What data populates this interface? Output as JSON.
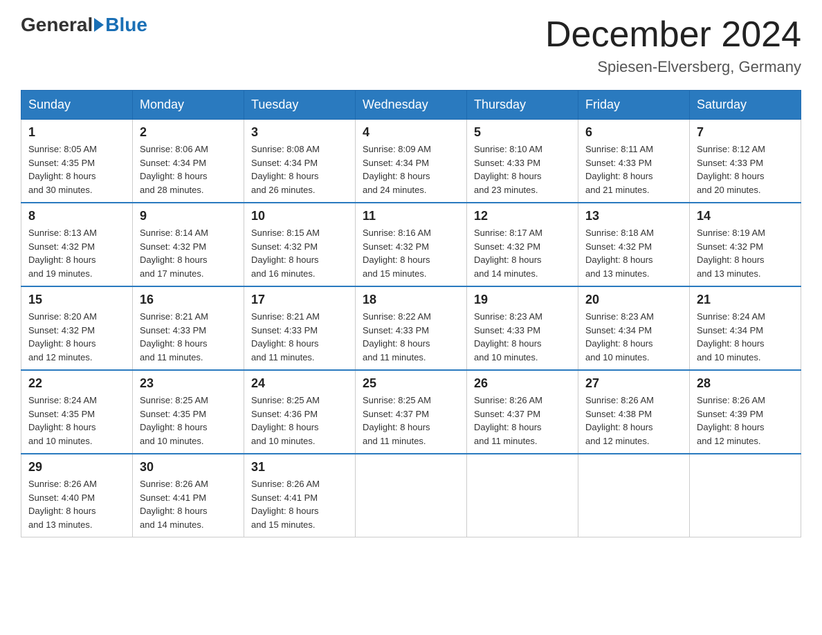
{
  "header": {
    "logo_general": "General",
    "logo_blue": "Blue",
    "title": "December 2024",
    "location": "Spiesen-Elversberg, Germany"
  },
  "days_of_week": [
    "Sunday",
    "Monday",
    "Tuesday",
    "Wednesday",
    "Thursday",
    "Friday",
    "Saturday"
  ],
  "weeks": [
    [
      {
        "day": "1",
        "sunrise": "8:05 AM",
        "sunset": "4:35 PM",
        "daylight": "8 hours and 30 minutes."
      },
      {
        "day": "2",
        "sunrise": "8:06 AM",
        "sunset": "4:34 PM",
        "daylight": "8 hours and 28 minutes."
      },
      {
        "day": "3",
        "sunrise": "8:08 AM",
        "sunset": "4:34 PM",
        "daylight": "8 hours and 26 minutes."
      },
      {
        "day": "4",
        "sunrise": "8:09 AM",
        "sunset": "4:34 PM",
        "daylight": "8 hours and 24 minutes."
      },
      {
        "day": "5",
        "sunrise": "8:10 AM",
        "sunset": "4:33 PM",
        "daylight": "8 hours and 23 minutes."
      },
      {
        "day": "6",
        "sunrise": "8:11 AM",
        "sunset": "4:33 PM",
        "daylight": "8 hours and 21 minutes."
      },
      {
        "day": "7",
        "sunrise": "8:12 AM",
        "sunset": "4:33 PM",
        "daylight": "8 hours and 20 minutes."
      }
    ],
    [
      {
        "day": "8",
        "sunrise": "8:13 AM",
        "sunset": "4:32 PM",
        "daylight": "8 hours and 19 minutes."
      },
      {
        "day": "9",
        "sunrise": "8:14 AM",
        "sunset": "4:32 PM",
        "daylight": "8 hours and 17 minutes."
      },
      {
        "day": "10",
        "sunrise": "8:15 AM",
        "sunset": "4:32 PM",
        "daylight": "8 hours and 16 minutes."
      },
      {
        "day": "11",
        "sunrise": "8:16 AM",
        "sunset": "4:32 PM",
        "daylight": "8 hours and 15 minutes."
      },
      {
        "day": "12",
        "sunrise": "8:17 AM",
        "sunset": "4:32 PM",
        "daylight": "8 hours and 14 minutes."
      },
      {
        "day": "13",
        "sunrise": "8:18 AM",
        "sunset": "4:32 PM",
        "daylight": "8 hours and 13 minutes."
      },
      {
        "day": "14",
        "sunrise": "8:19 AM",
        "sunset": "4:32 PM",
        "daylight": "8 hours and 13 minutes."
      }
    ],
    [
      {
        "day": "15",
        "sunrise": "8:20 AM",
        "sunset": "4:32 PM",
        "daylight": "8 hours and 12 minutes."
      },
      {
        "day": "16",
        "sunrise": "8:21 AM",
        "sunset": "4:33 PM",
        "daylight": "8 hours and 11 minutes."
      },
      {
        "day": "17",
        "sunrise": "8:21 AM",
        "sunset": "4:33 PM",
        "daylight": "8 hours and 11 minutes."
      },
      {
        "day": "18",
        "sunrise": "8:22 AM",
        "sunset": "4:33 PM",
        "daylight": "8 hours and 11 minutes."
      },
      {
        "day": "19",
        "sunrise": "8:23 AM",
        "sunset": "4:33 PM",
        "daylight": "8 hours and 10 minutes."
      },
      {
        "day": "20",
        "sunrise": "8:23 AM",
        "sunset": "4:34 PM",
        "daylight": "8 hours and 10 minutes."
      },
      {
        "day": "21",
        "sunrise": "8:24 AM",
        "sunset": "4:34 PM",
        "daylight": "8 hours and 10 minutes."
      }
    ],
    [
      {
        "day": "22",
        "sunrise": "8:24 AM",
        "sunset": "4:35 PM",
        "daylight": "8 hours and 10 minutes."
      },
      {
        "day": "23",
        "sunrise": "8:25 AM",
        "sunset": "4:35 PM",
        "daylight": "8 hours and 10 minutes."
      },
      {
        "day": "24",
        "sunrise": "8:25 AM",
        "sunset": "4:36 PM",
        "daylight": "8 hours and 10 minutes."
      },
      {
        "day": "25",
        "sunrise": "8:25 AM",
        "sunset": "4:37 PM",
        "daylight": "8 hours and 11 minutes."
      },
      {
        "day": "26",
        "sunrise": "8:26 AM",
        "sunset": "4:37 PM",
        "daylight": "8 hours and 11 minutes."
      },
      {
        "day": "27",
        "sunrise": "8:26 AM",
        "sunset": "4:38 PM",
        "daylight": "8 hours and 12 minutes."
      },
      {
        "day": "28",
        "sunrise": "8:26 AM",
        "sunset": "4:39 PM",
        "daylight": "8 hours and 12 minutes."
      }
    ],
    [
      {
        "day": "29",
        "sunrise": "8:26 AM",
        "sunset": "4:40 PM",
        "daylight": "8 hours and 13 minutes."
      },
      {
        "day": "30",
        "sunrise": "8:26 AM",
        "sunset": "4:41 PM",
        "daylight": "8 hours and 14 minutes."
      },
      {
        "day": "31",
        "sunrise": "8:26 AM",
        "sunset": "4:41 PM",
        "daylight": "8 hours and 15 minutes."
      },
      null,
      null,
      null,
      null
    ]
  ],
  "labels": {
    "sunrise_prefix": "Sunrise: ",
    "sunset_prefix": "Sunset: ",
    "daylight_prefix": "Daylight: "
  }
}
